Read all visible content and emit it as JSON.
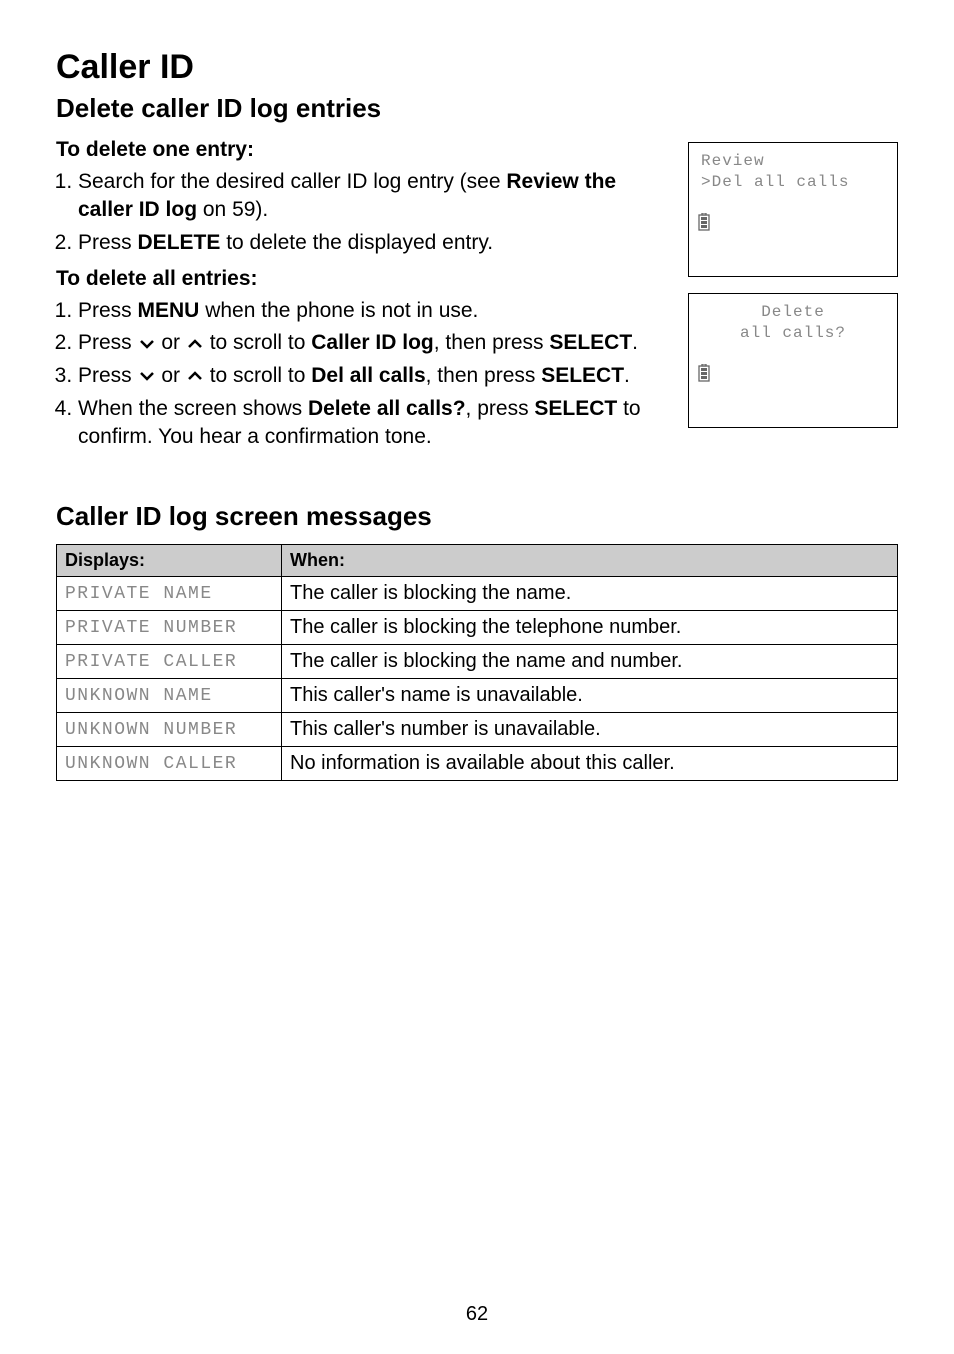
{
  "title": "Caller ID",
  "subtitle": "Delete caller ID log entries",
  "section_one": {
    "heading": "To delete one entry:",
    "items": {
      "0": {
        "pre": "Search for the desired caller ID log entry (see ",
        "bold": "Review the caller ID log",
        "post": " on 59)."
      },
      "1": {
        "pre": "Press ",
        "bold": "DELETE",
        "post": " to delete the displayed entry."
      }
    }
  },
  "section_all": {
    "heading": "To delete all entries:",
    "items": {
      "0": {
        "pre": "Press ",
        "bold": "MENU",
        "post": " when the phone is not in use."
      },
      "1": {
        "t1": "Press ",
        "t2": " or ",
        "t3": " to scroll to ",
        "b1": "Caller ID log",
        "t4": ", then press ",
        "b2": "SELECT",
        "t5": "."
      },
      "2": {
        "t1": "Press ",
        "t2": " or ",
        "t3": " to scroll to ",
        "b1": "Del all calls",
        "t4": ", then press ",
        "b2": "SELECT",
        "t5": "."
      },
      "3": {
        "t1": "When the screen shows ",
        "b1": "Delete all calls?",
        "t2": ", press ",
        "b2": "SELECT",
        "t3": " to confirm. You hear a confirmation tone."
      }
    }
  },
  "lcd1": {
    "line1": " Review",
    "line2": ">Del all calls"
  },
  "lcd2": {
    "line1": "Delete",
    "line2": "all calls?"
  },
  "messages_heading": "Caller ID log screen messages",
  "table": {
    "header": {
      "col1": "Displays:",
      "col2": "When:"
    },
    "rows": [
      {
        "code": "PRIVATE NAME",
        "desc": "The caller is blocking the name."
      },
      {
        "code": "PRIVATE NUMBER",
        "desc": "The caller is blocking the telephone number."
      },
      {
        "code": "PRIVATE CALLER",
        "desc": "The caller is blocking the name and number."
      },
      {
        "code": "UNKNOWN NAME",
        "desc": "This caller's name is unavailable."
      },
      {
        "code": "UNKNOWN NUMBER",
        "desc": "This caller's number is unavailable."
      },
      {
        "code": "UNKNOWN CALLER",
        "desc": "No information is available about this caller."
      }
    ]
  },
  "page_number": "62"
}
